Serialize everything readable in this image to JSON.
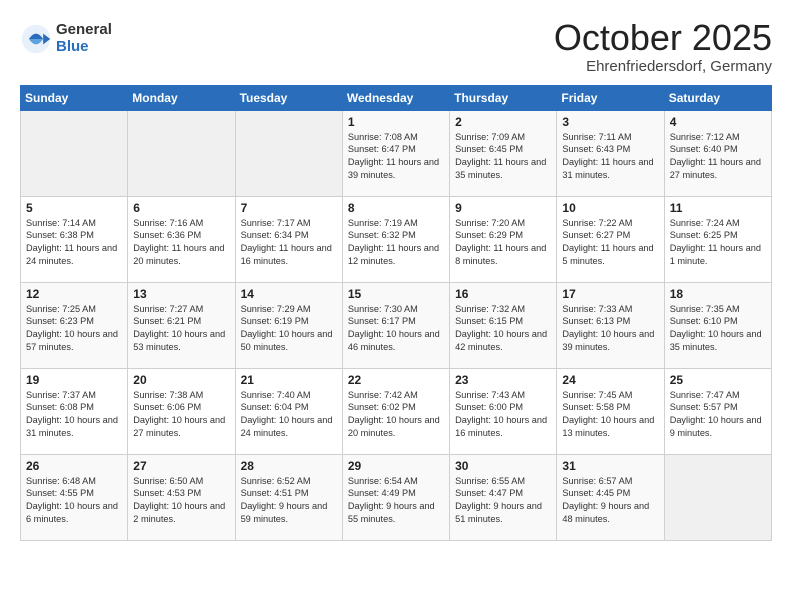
{
  "header": {
    "logo_general": "General",
    "logo_blue": "Blue",
    "month": "October 2025",
    "location": "Ehrenfriedersdorf, Germany"
  },
  "days_of_week": [
    "Sunday",
    "Monday",
    "Tuesday",
    "Wednesday",
    "Thursday",
    "Friday",
    "Saturday"
  ],
  "weeks": [
    [
      {
        "day": "",
        "sunrise": "",
        "sunset": "",
        "daylight": "",
        "empty": true
      },
      {
        "day": "",
        "sunrise": "",
        "sunset": "",
        "daylight": "",
        "empty": true
      },
      {
        "day": "",
        "sunrise": "",
        "sunset": "",
        "daylight": "",
        "empty": true
      },
      {
        "day": "1",
        "sunrise": "Sunrise: 7:08 AM",
        "sunset": "Sunset: 6:47 PM",
        "daylight": "Daylight: 11 hours and 39 minutes."
      },
      {
        "day": "2",
        "sunrise": "Sunrise: 7:09 AM",
        "sunset": "Sunset: 6:45 PM",
        "daylight": "Daylight: 11 hours and 35 minutes."
      },
      {
        "day": "3",
        "sunrise": "Sunrise: 7:11 AM",
        "sunset": "Sunset: 6:43 PM",
        "daylight": "Daylight: 11 hours and 31 minutes."
      },
      {
        "day": "4",
        "sunrise": "Sunrise: 7:12 AM",
        "sunset": "Sunset: 6:40 PM",
        "daylight": "Daylight: 11 hours and 27 minutes."
      }
    ],
    [
      {
        "day": "5",
        "sunrise": "Sunrise: 7:14 AM",
        "sunset": "Sunset: 6:38 PM",
        "daylight": "Daylight: 11 hours and 24 minutes."
      },
      {
        "day": "6",
        "sunrise": "Sunrise: 7:16 AM",
        "sunset": "Sunset: 6:36 PM",
        "daylight": "Daylight: 11 hours and 20 minutes."
      },
      {
        "day": "7",
        "sunrise": "Sunrise: 7:17 AM",
        "sunset": "Sunset: 6:34 PM",
        "daylight": "Daylight: 11 hours and 16 minutes."
      },
      {
        "day": "8",
        "sunrise": "Sunrise: 7:19 AM",
        "sunset": "Sunset: 6:32 PM",
        "daylight": "Daylight: 11 hours and 12 minutes."
      },
      {
        "day": "9",
        "sunrise": "Sunrise: 7:20 AM",
        "sunset": "Sunset: 6:29 PM",
        "daylight": "Daylight: 11 hours and 8 minutes."
      },
      {
        "day": "10",
        "sunrise": "Sunrise: 7:22 AM",
        "sunset": "Sunset: 6:27 PM",
        "daylight": "Daylight: 11 hours and 5 minutes."
      },
      {
        "day": "11",
        "sunrise": "Sunrise: 7:24 AM",
        "sunset": "Sunset: 6:25 PM",
        "daylight": "Daylight: 11 hours and 1 minute."
      }
    ],
    [
      {
        "day": "12",
        "sunrise": "Sunrise: 7:25 AM",
        "sunset": "Sunset: 6:23 PM",
        "daylight": "Daylight: 10 hours and 57 minutes."
      },
      {
        "day": "13",
        "sunrise": "Sunrise: 7:27 AM",
        "sunset": "Sunset: 6:21 PM",
        "daylight": "Daylight: 10 hours and 53 minutes."
      },
      {
        "day": "14",
        "sunrise": "Sunrise: 7:29 AM",
        "sunset": "Sunset: 6:19 PM",
        "daylight": "Daylight: 10 hours and 50 minutes."
      },
      {
        "day": "15",
        "sunrise": "Sunrise: 7:30 AM",
        "sunset": "Sunset: 6:17 PM",
        "daylight": "Daylight: 10 hours and 46 minutes."
      },
      {
        "day": "16",
        "sunrise": "Sunrise: 7:32 AM",
        "sunset": "Sunset: 6:15 PM",
        "daylight": "Daylight: 10 hours and 42 minutes."
      },
      {
        "day": "17",
        "sunrise": "Sunrise: 7:33 AM",
        "sunset": "Sunset: 6:13 PM",
        "daylight": "Daylight: 10 hours and 39 minutes."
      },
      {
        "day": "18",
        "sunrise": "Sunrise: 7:35 AM",
        "sunset": "Sunset: 6:10 PM",
        "daylight": "Daylight: 10 hours and 35 minutes."
      }
    ],
    [
      {
        "day": "19",
        "sunrise": "Sunrise: 7:37 AM",
        "sunset": "Sunset: 6:08 PM",
        "daylight": "Daylight: 10 hours and 31 minutes."
      },
      {
        "day": "20",
        "sunrise": "Sunrise: 7:38 AM",
        "sunset": "Sunset: 6:06 PM",
        "daylight": "Daylight: 10 hours and 27 minutes."
      },
      {
        "day": "21",
        "sunrise": "Sunrise: 7:40 AM",
        "sunset": "Sunset: 6:04 PM",
        "daylight": "Daylight: 10 hours and 24 minutes."
      },
      {
        "day": "22",
        "sunrise": "Sunrise: 7:42 AM",
        "sunset": "Sunset: 6:02 PM",
        "daylight": "Daylight: 10 hours and 20 minutes."
      },
      {
        "day": "23",
        "sunrise": "Sunrise: 7:43 AM",
        "sunset": "Sunset: 6:00 PM",
        "daylight": "Daylight: 10 hours and 16 minutes."
      },
      {
        "day": "24",
        "sunrise": "Sunrise: 7:45 AM",
        "sunset": "Sunset: 5:58 PM",
        "daylight": "Daylight: 10 hours and 13 minutes."
      },
      {
        "day": "25",
        "sunrise": "Sunrise: 7:47 AM",
        "sunset": "Sunset: 5:57 PM",
        "daylight": "Daylight: 10 hours and 9 minutes."
      }
    ],
    [
      {
        "day": "26",
        "sunrise": "Sunrise: 6:48 AM",
        "sunset": "Sunset: 4:55 PM",
        "daylight": "Daylight: 10 hours and 6 minutes."
      },
      {
        "day": "27",
        "sunrise": "Sunrise: 6:50 AM",
        "sunset": "Sunset: 4:53 PM",
        "daylight": "Daylight: 10 hours and 2 minutes."
      },
      {
        "day": "28",
        "sunrise": "Sunrise: 6:52 AM",
        "sunset": "Sunset: 4:51 PM",
        "daylight": "Daylight: 9 hours and 59 minutes."
      },
      {
        "day": "29",
        "sunrise": "Sunrise: 6:54 AM",
        "sunset": "Sunset: 4:49 PM",
        "daylight": "Daylight: 9 hours and 55 minutes."
      },
      {
        "day": "30",
        "sunrise": "Sunrise: 6:55 AM",
        "sunset": "Sunset: 4:47 PM",
        "daylight": "Daylight: 9 hours and 51 minutes."
      },
      {
        "day": "31",
        "sunrise": "Sunrise: 6:57 AM",
        "sunset": "Sunset: 4:45 PM",
        "daylight": "Daylight: 9 hours and 48 minutes."
      },
      {
        "day": "",
        "sunrise": "",
        "sunset": "",
        "daylight": "",
        "empty": true
      }
    ]
  ]
}
